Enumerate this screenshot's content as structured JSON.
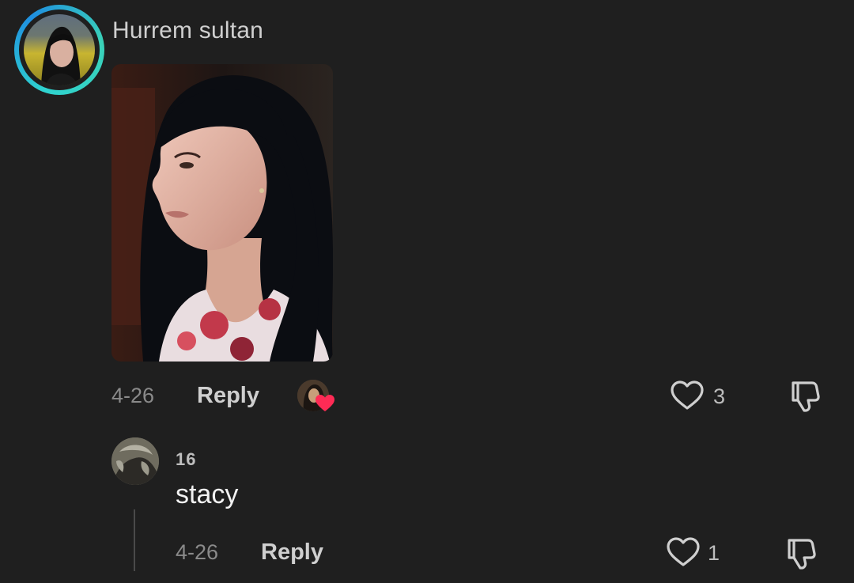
{
  "comment": {
    "username": "Hurrem sultan",
    "date": "4-26",
    "reply_label": "Reply",
    "like_count": "3",
    "icons": {
      "avatar": "profile-avatar",
      "photo": "attached-photo",
      "liked_by_creator": "creator-heart-badge-icon",
      "like": "heart-outline-icon",
      "dislike": "thumbs-down-icon"
    },
    "colors": {
      "ring": "#2fd3d0",
      "heart_badge": "#ff2b55"
    }
  },
  "reply": {
    "username": "16",
    "text": "stacy",
    "date": "4-26",
    "reply_label": "Reply",
    "like_count": "1",
    "icons": {
      "avatar": "profile-avatar",
      "like": "heart-outline-icon",
      "dislike": "thumbs-down-icon"
    }
  }
}
